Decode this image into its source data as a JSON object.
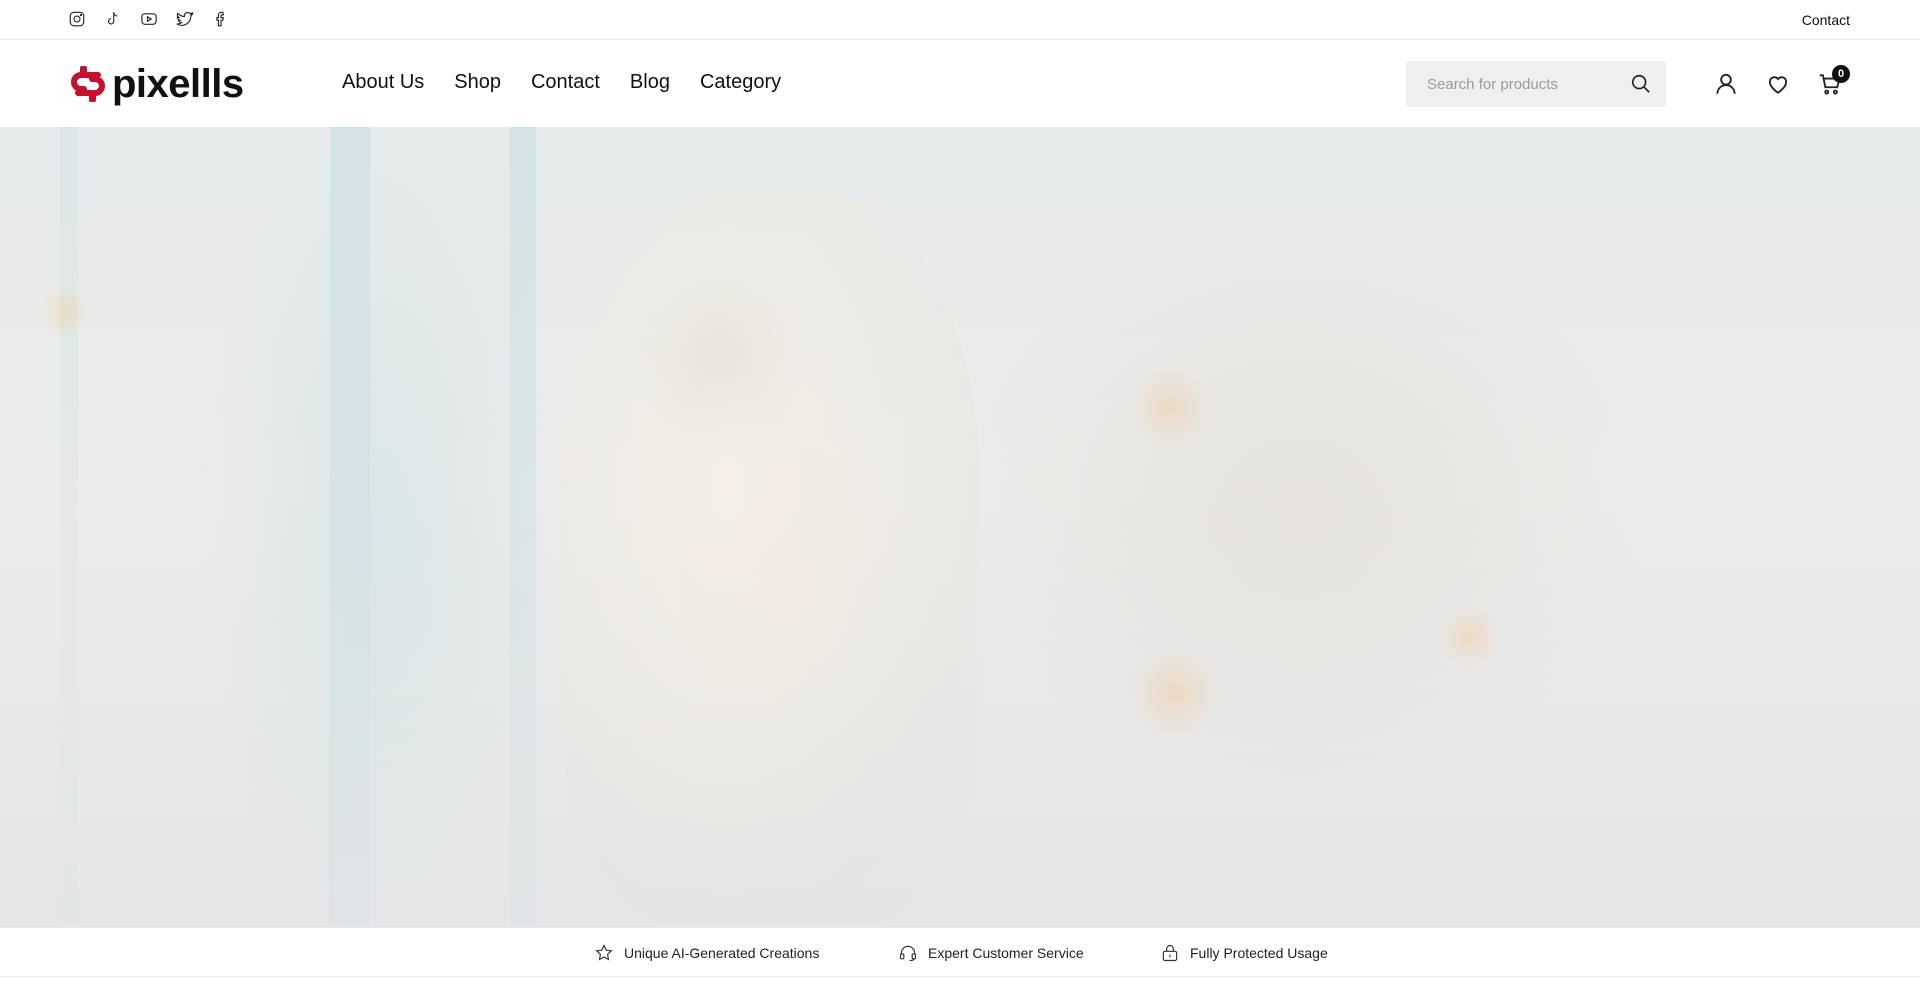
{
  "topbar": {
    "socials": [
      {
        "icon": "instagram-icon"
      },
      {
        "icon": "tiktok-icon"
      },
      {
        "icon": "youtube-icon"
      },
      {
        "icon": "twitter-icon"
      },
      {
        "icon": "facebook-icon"
      }
    ],
    "contact_label": "Contact"
  },
  "header": {
    "logo_text": "pixellls",
    "brand_color": "#c8102e",
    "nav": [
      "About Us",
      "Shop",
      "Contact",
      "Blog",
      "Category"
    ],
    "search": {
      "placeholder": "Search for products",
      "value": ""
    },
    "cart_count": "0"
  },
  "features": [
    {
      "icon": "star-icon",
      "label": "Unique AI-Generated Creations"
    },
    {
      "icon": "headset-icon",
      "label": "Expert Customer Service"
    },
    {
      "icon": "lock-icon",
      "label": "Fully Protected Usage"
    }
  ]
}
